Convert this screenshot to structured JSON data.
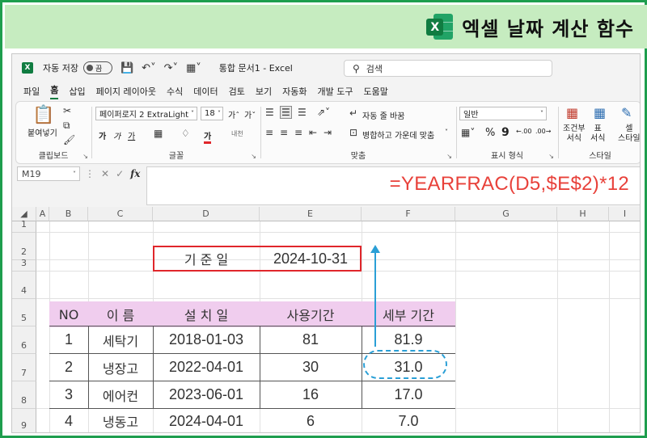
{
  "banner": {
    "title": "엑셀 날짜 계산 함수",
    "logo_letter": "X"
  },
  "titlebar": {
    "app_icon_letter": "X",
    "autosave_label": "자동 저장",
    "autosave_state": "끔",
    "doc_title": "통합 문서1 - Excel",
    "search_placeholder": "검색",
    "icons": [
      "save-icon",
      "undo-icon",
      "redo-icon",
      "customize-icon"
    ]
  },
  "tabs": [
    "파일",
    "홈",
    "삽입",
    "페이지 레이아웃",
    "수식",
    "데이터",
    "검토",
    "보기",
    "자동화",
    "개발 도구",
    "도움말"
  ],
  "ribbon": {
    "clipboard": {
      "paste": "붙여넣기",
      "label": "클립보드"
    },
    "font": {
      "name": "페이퍼로지 2 ExtraLight",
      "size": "18",
      "label": "글꼴",
      "bold": "가",
      "italic": "가",
      "underline": "가",
      "font_color_sample": "가",
      "ruby": "내천"
    },
    "alignment": {
      "wrap": "자동 줄 바꿈",
      "merge": "병합하고 가운데 맞춤",
      "label": "맞춤"
    },
    "number": {
      "format": "일반",
      "percent": "%",
      "comma": "9",
      "label": "표시 형식"
    },
    "styles": {
      "conditional": [
        "조건부",
        "서식"
      ],
      "table": [
        "표",
        "서식"
      ],
      "cell": [
        "셀",
        "스타일"
      ],
      "label": "스타일"
    }
  },
  "formula_bar": {
    "name_box": "M19",
    "fx": "fx",
    "formula": "=YEARFRAC(D5,$E$2)*12"
  },
  "sheet": {
    "columns": [
      "A",
      "B",
      "C",
      "D",
      "E",
      "F",
      "G",
      "H",
      "I"
    ],
    "rows": [
      "1",
      "2",
      "3",
      "4",
      "5",
      "6",
      "7",
      "8",
      "9"
    ],
    "ref_label": "기 준 일",
    "ref_date": "2024-10-31",
    "headers": [
      "NO",
      "이 름",
      "설 치 일",
      "사용기간",
      "세부 기간"
    ],
    "data": [
      [
        "1",
        "세탁기",
        "2018-01-03",
        "81",
        "81.9"
      ],
      [
        "2",
        "냉장고",
        "2022-04-01",
        "30",
        "31.0"
      ],
      [
        "3",
        "에어컨",
        "2023-06-01",
        "16",
        "17.0"
      ],
      [
        "4",
        "냉동고",
        "2024-04-01",
        "6",
        "7.0"
      ]
    ]
  },
  "colors": {
    "accent_green": "#1e9e4e",
    "banner_bg": "#c6ecc0",
    "header_band": "#f0cdee",
    "highlight_red": "#e0262b",
    "annotation_blue": "#2a9fd6",
    "formula_red": "#e8413a"
  }
}
